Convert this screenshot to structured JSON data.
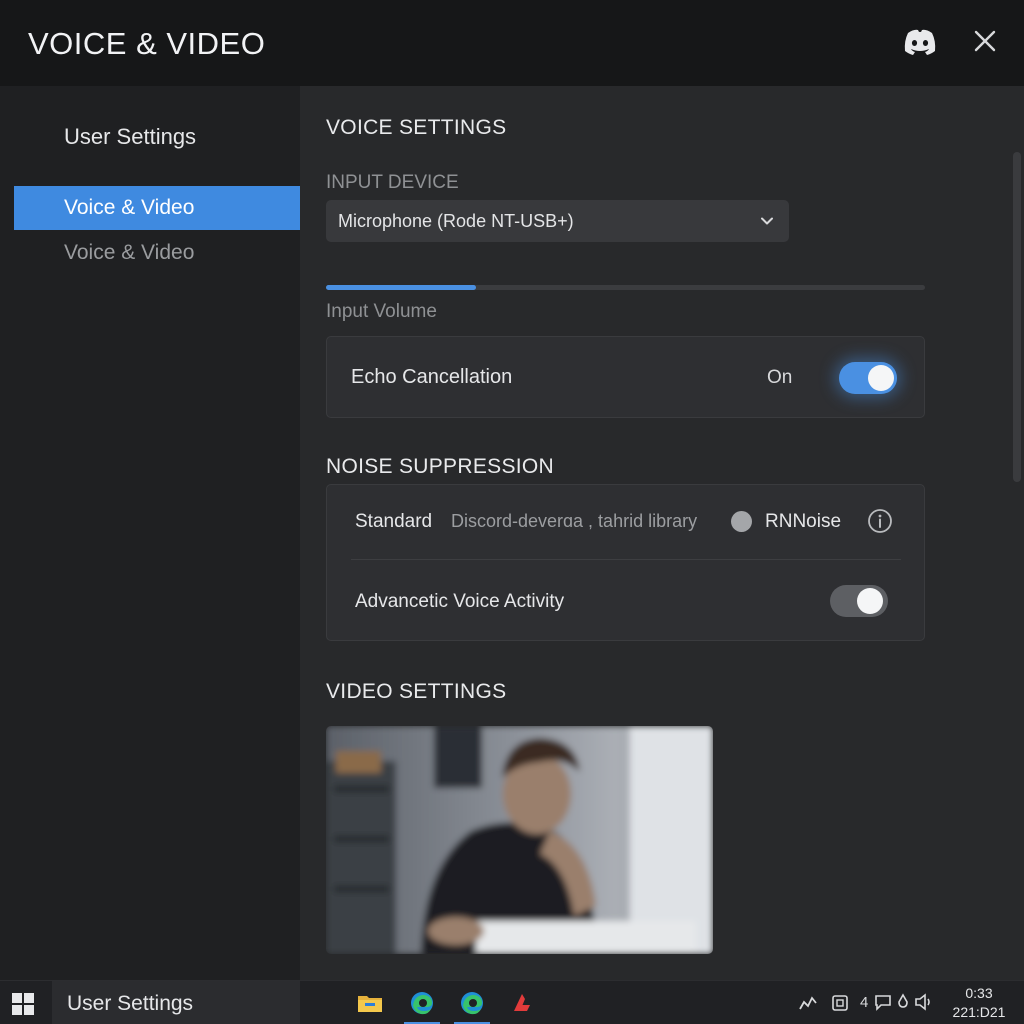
{
  "window": {
    "title": "VOICE & VIDEO",
    "icons": {
      "app": "discord-icon",
      "close": "close-icon"
    }
  },
  "sidebar": {
    "heading": "User Settings",
    "items": [
      {
        "label": "Voice & Video",
        "active": true
      },
      {
        "label": "Voice & Video",
        "active": false
      }
    ]
  },
  "voice": {
    "section_title": "VOICE SETTINGS",
    "input_device_label": "INPUT DEVICE",
    "input_device_value": "Microphone (Rode NT-USB+)",
    "input_volume_label": "Input Volume",
    "input_volume_level": 0.25,
    "echo_cancellation": {
      "label": "Echo Cancellation",
      "state_text": "On",
      "enabled": true
    }
  },
  "noise": {
    "section_title": "NOISE SUPPRESSION",
    "option_standard": "Standard",
    "option_standard_desc": "Discord-deverɑa , tahrid library",
    "option_rnnoise": "RNNoise",
    "advanced_label": "Advancetic Voice Activity",
    "advanced_enabled": false
  },
  "video": {
    "section_title": "VIDEO SETTINGS",
    "preview": "camera-preview"
  },
  "taskbar": {
    "app_label": "User Settings",
    "icons": [
      "windows-start-icon",
      "file-explorer-icon",
      "edge-icon",
      "edge-icon",
      "app-icon"
    ],
    "tray_text": "4",
    "clock_time": "0:33",
    "clock_date": "221:D21"
  },
  "colors": {
    "accent": "#4a90e2",
    "background": "#28292b",
    "sidebar": "#1f2022",
    "titlebar": "#161718"
  }
}
